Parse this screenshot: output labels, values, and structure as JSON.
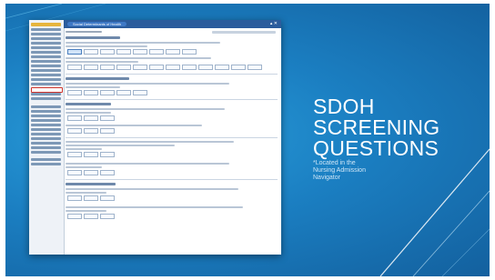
{
  "slide": {
    "heading_lines": [
      "SDOH",
      "SCREENING",
      "QUESTIONS"
    ],
    "note_lines": [
      "*Located in the",
      "Nursing Admission",
      "Navigator"
    ]
  },
  "screenshot": {
    "title": "Social Determinants of Health"
  },
  "colors": {
    "background_center": "#2aa0dc",
    "background_edge": "#13609e",
    "heading_text": "#ffffff",
    "note_text": "#cfe6f7",
    "screenshot_titlebar": "#2b5c9c",
    "screenshot_nav_selected": "#e6b53d",
    "screenshot_highlight_box": "#d0342c"
  }
}
